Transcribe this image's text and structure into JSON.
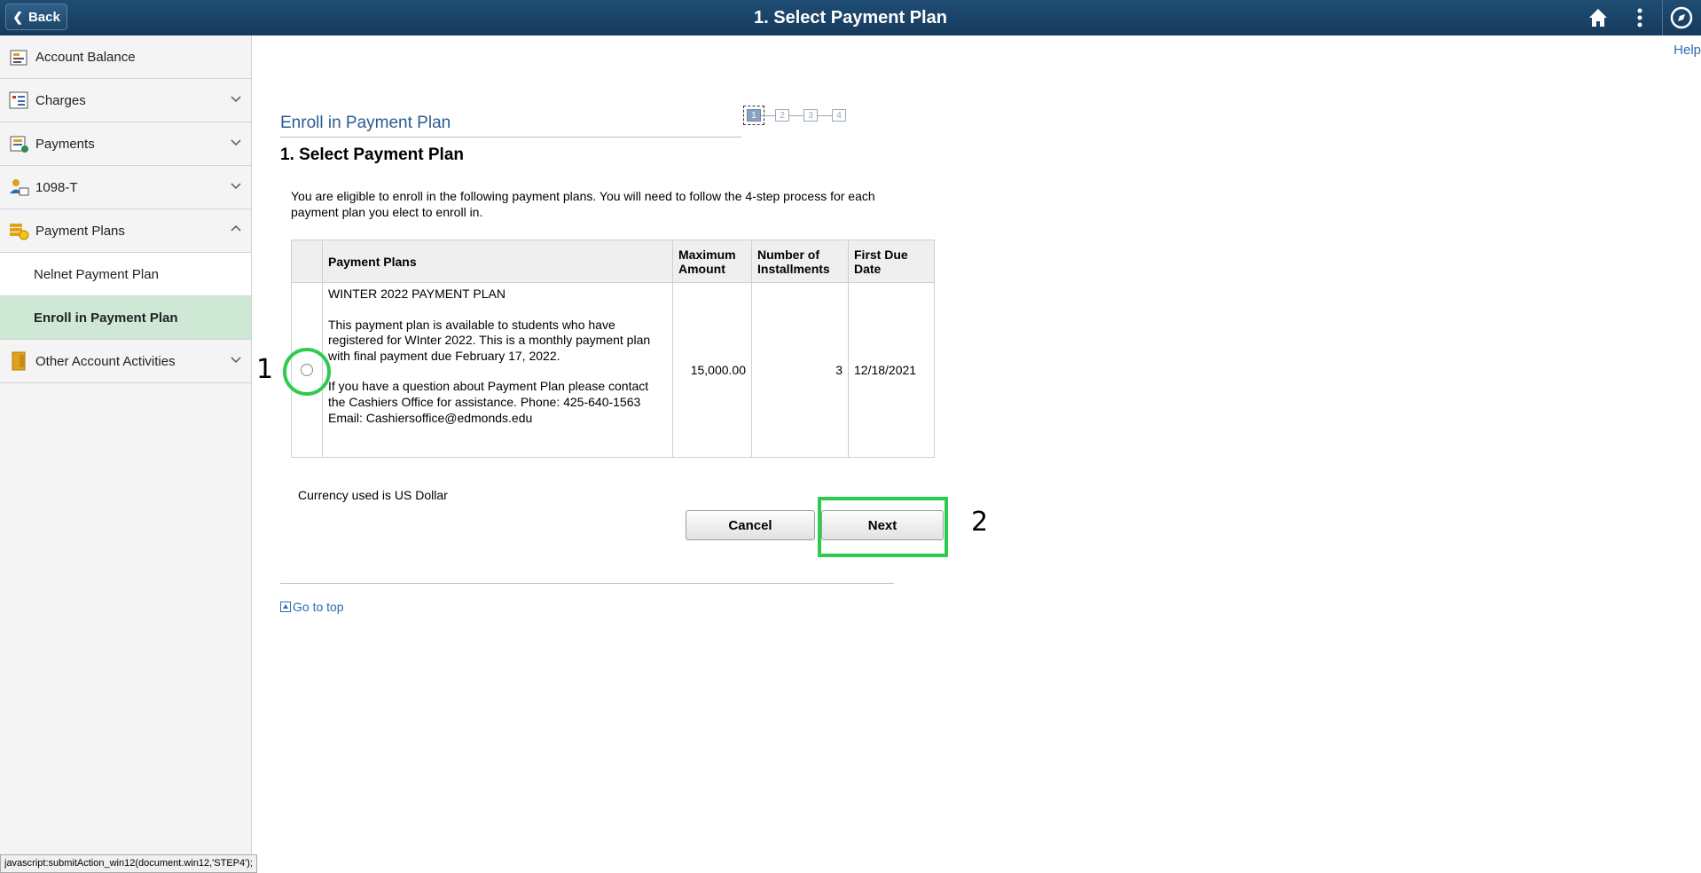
{
  "header": {
    "back_label": "Back",
    "title": "1. Select Payment Plan"
  },
  "help": "Help",
  "sidebar": {
    "items": [
      {
        "label": "Account Balance"
      },
      {
        "label": "Charges"
      },
      {
        "label": "Payments"
      },
      {
        "label": "1098-T"
      },
      {
        "label": "Payment Plans"
      }
    ],
    "sub_items": [
      {
        "label": "Nelnet Payment Plan"
      },
      {
        "label": "Enroll in Payment Plan"
      }
    ],
    "tail_item": {
      "label": "Other Account Activities"
    }
  },
  "main": {
    "section_title": "Enroll in Payment Plan",
    "steps": [
      "1",
      "2",
      "3",
      "4"
    ],
    "heading": "1. Select Payment Plan",
    "intro": "You are eligible to enroll in the following payment plans. You will need to follow the 4-step process for each payment plan you elect to enroll in.",
    "table": {
      "headers": {
        "plans": "Payment Plans",
        "max_amount": "Maximum Amount",
        "installments": "Number of Installments",
        "first_due": "First Due Date"
      },
      "row": {
        "name": "WINTER 2022 PAYMENT PLAN",
        "desc1": "This payment plan is available to students who have registered for WInter 2022.  This is a monthly payment plan with final payment due February 17, 2022.",
        "desc2": "If you have a question about Payment Plan please contact the Cashiers Office for assistance. Phone: 425-640-1563 Email: Cashiersoffice@edmonds.edu",
        "max_amount": "15,000.00",
        "installments": "3",
        "first_due": "12/18/2021"
      }
    },
    "currency_note": "Currency used is US Dollar",
    "cancel_label": "Cancel",
    "next_label": "Next",
    "goto_top": "Go to top"
  },
  "annotations": {
    "one": "1",
    "two": "2"
  },
  "status_bar": "javascript:submitAction_win12(document.win12,'STEP4');"
}
